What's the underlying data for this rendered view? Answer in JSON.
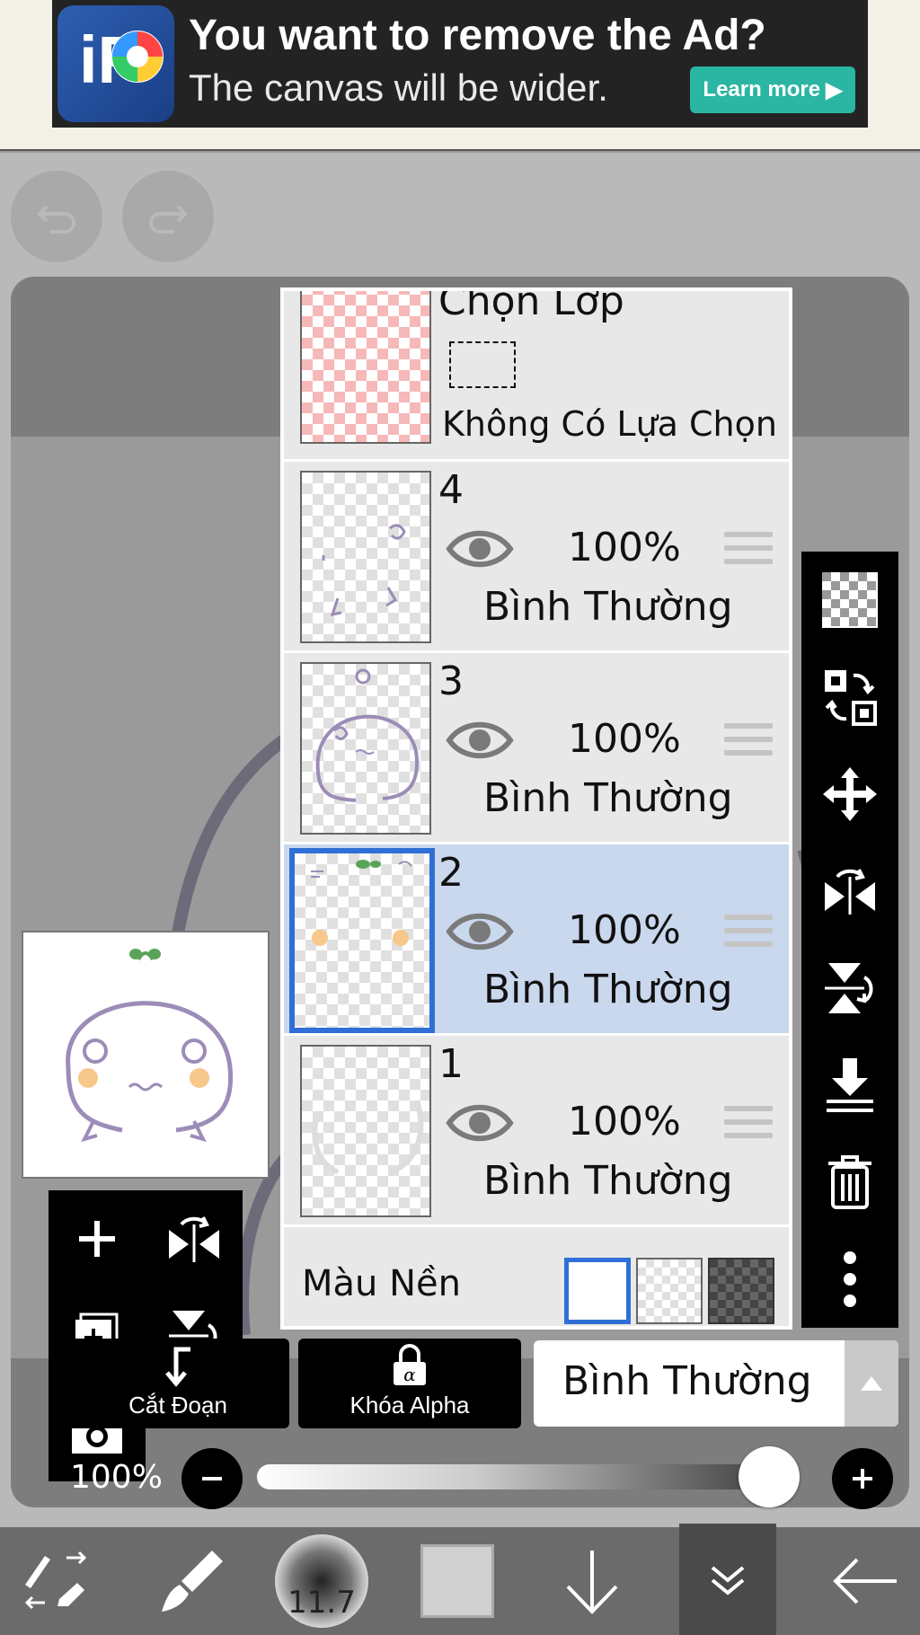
{
  "ad": {
    "title": "You want to remove the Ad?",
    "subtitle": "The canvas will be wider.",
    "button": "Learn more"
  },
  "layers_panel": {
    "selection_layer": {
      "title": "Chọn Lớp",
      "status": "Không Có Lựa Chọn"
    },
    "layers": [
      {
        "number": "4",
        "opacity": "100%",
        "blend": "Bình Thường",
        "selected": false
      },
      {
        "number": "3",
        "opacity": "100%",
        "blend": "Bình Thường",
        "selected": false
      },
      {
        "number": "2",
        "opacity": "100%",
        "blend": "Bình Thường",
        "selected": true
      },
      {
        "number": "1",
        "opacity": "100%",
        "blend": "Bình Thường",
        "selected": false
      }
    ],
    "background_color_label": "Màu Nền",
    "background_options": [
      "white",
      "transparent-light",
      "transparent-dark"
    ]
  },
  "controls": {
    "clipping_label": "Cắt Đoạn",
    "alpha_lock_label": "Khóa Alpha",
    "blend_mode": "Bình Thường",
    "opacity_label": "100%",
    "opacity_value": 1.0
  },
  "bottom_bar": {
    "brush_size": "11.7"
  },
  "colors": {
    "selected_layer_bg": "#cad8ee",
    "selection_accent": "#2f6fd6",
    "ad_button": "#2bb5a3"
  },
  "icons": {
    "left_tools": [
      "plus-icon",
      "flip-horizontal-icon",
      "add-layer-icon",
      "flip-vertical-icon",
      "camera-icon"
    ],
    "right_tools": [
      "checker-icon",
      "swap-layer-icon",
      "move-icon",
      "flip-horizontal-icon",
      "flip-vertical-icon",
      "merge-down-icon",
      "trash-icon",
      "more-icon"
    ],
    "bottom": [
      "tool-switch-icon",
      "brush-icon",
      "brush-size-icon",
      "color-swatch-icon",
      "down-arrow-icon",
      "expand-icon",
      "back-arrow-icon"
    ]
  }
}
